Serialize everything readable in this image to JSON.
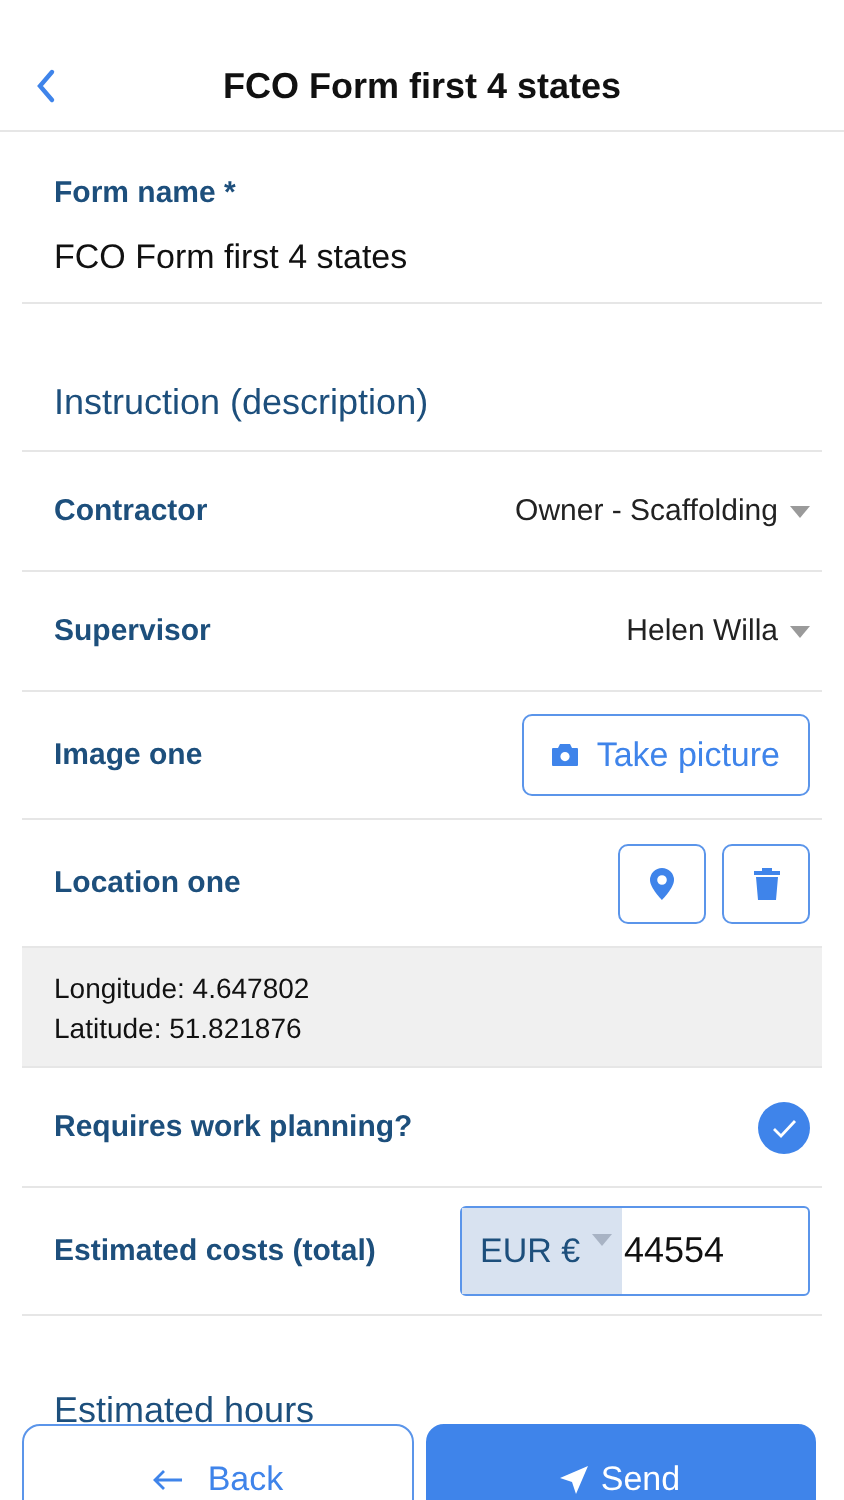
{
  "header": {
    "title": "FCO Form first 4 states"
  },
  "form_name": {
    "label": "Form name *",
    "value": "FCO Form first 4 states"
  },
  "section_title": "Instruction (description)",
  "fields": [
    {
      "kind": "select",
      "label": "Contractor",
      "value": "Owner - Scaffolding"
    },
    {
      "kind": "select",
      "label": "Supervisor",
      "value": "Helen Willa"
    },
    {
      "kind": "photo",
      "label": "Image one",
      "button": "Take picture"
    },
    {
      "kind": "location",
      "label": "Location one",
      "coordinates": [
        "Longitude: 4.647802",
        "Latitude: 51.821876"
      ]
    },
    {
      "kind": "checkbox",
      "label": "Requires work planning?",
      "checked": true
    },
    {
      "kind": "currency",
      "label": "Estimated costs (total)",
      "currency": "EUR €",
      "value": "44554"
    },
    {
      "kind": "heading",
      "label": "Estimated hours"
    }
  ],
  "footer": {
    "back": "Back",
    "send": "Send"
  }
}
